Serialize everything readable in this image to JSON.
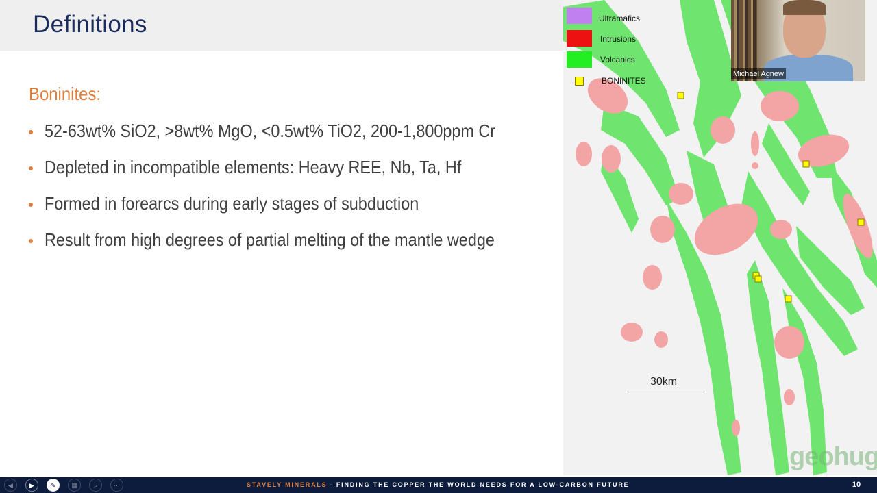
{
  "slide": {
    "title": "Definitions",
    "subheading": "Boninites:",
    "bullets": [
      "52-63wt% SiO2, >8wt% MgO, <0.5wt% TiO2, 200-1,800ppm Cr",
      "Depleted in incompatible elements: Heavy REE, Nb, Ta, Hf",
      "Formed in forearcs during early stages of subduction",
      "Result from high degrees of partial melting of the mantle wedge"
    ],
    "page_number": "10"
  },
  "map": {
    "legend": [
      {
        "label": "Ultramafics",
        "color": "#c080f0"
      },
      {
        "label": "Intrusions",
        "color": "#ee1111"
      },
      {
        "label": "Volcanics",
        "color": "#22ee22"
      },
      {
        "label": "BONINITES",
        "color": "#ffff00"
      }
    ],
    "scale_label": "30km",
    "colors": {
      "intrusion_fill": "#f3a5a5",
      "volcanic_fill": "#6fe46f",
      "background": "#f2f2f2"
    },
    "watermark": "geohug"
  },
  "webcam": {
    "participant_name": "Michael Agnew"
  },
  "footer": {
    "brand": "STAVELY MINERALS",
    "tagline": " - FINDING THE COPPER THE WORLD NEEDS FOR A LOW-CARBON FUTURE"
  },
  "controls": [
    {
      "icon": "previous-icon",
      "glyph": "◀"
    },
    {
      "icon": "next-icon",
      "glyph": "▶"
    },
    {
      "icon": "pen-icon",
      "glyph": "✎"
    },
    {
      "icon": "slides-icon",
      "glyph": "▦"
    },
    {
      "icon": "zoom-icon",
      "glyph": "⌕"
    },
    {
      "icon": "more-options-icon",
      "glyph": "⋯"
    }
  ]
}
